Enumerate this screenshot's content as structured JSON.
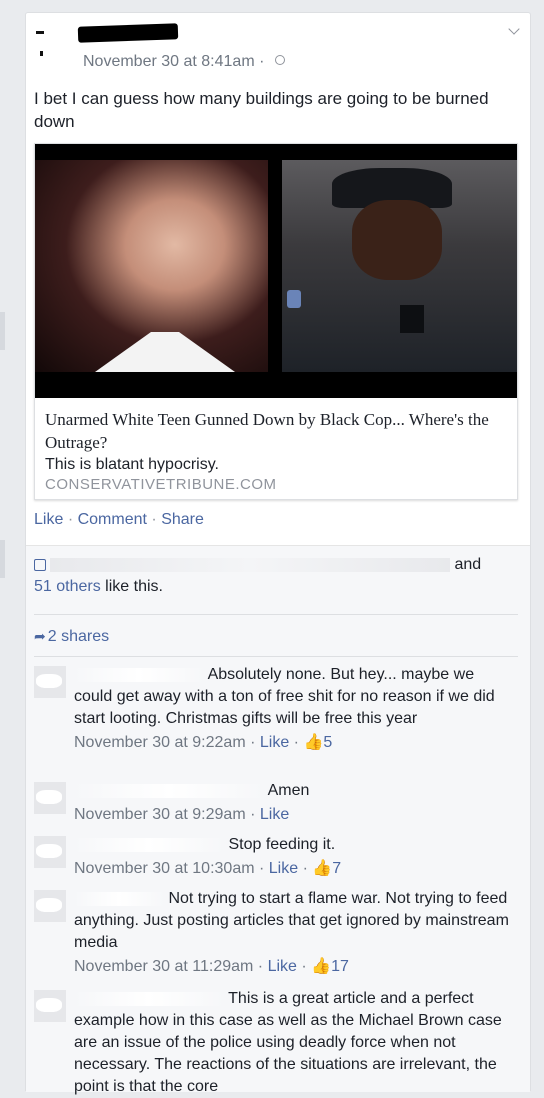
{
  "post": {
    "timestamp": "November 30 at 8:41am",
    "dot": "·",
    "text": "I bet I can guess how many buildings are going to be burned down"
  },
  "link_card": {
    "title": "Unarmed White Teen Gunned Down by Black Cop... Where's the Outrage?",
    "description": "This is blatant hypocrisy.",
    "domain": "CONSERVATIVETRIBUNE.COM"
  },
  "actions": {
    "like": "Like",
    "comment": "Comment",
    "share": "Share",
    "sep": "·"
  },
  "likes_row": {
    "suffix": "and",
    "others": "51 others",
    "tail": "like this."
  },
  "shares": {
    "label": "2 shares"
  },
  "comments": [
    {
      "text": "Absolutely none. But hey... maybe we could get away with a ton of free shit for no reason if we did start looting. Christmas gifts will be free this year",
      "time": "November 30 at 9:22am",
      "like": "Like",
      "likes": "5"
    },
    {
      "text": "Amen",
      "time": "November 30 at 9:29am",
      "like": "Like",
      "likes": ""
    },
    {
      "text": "Stop feeding it.",
      "time": "November 30 at 10:30am",
      "like": "Like",
      "likes": "7"
    },
    {
      "text": "Not trying to start a flame war. Not trying to feed anything. Just posting articles that get ignored by mainstream media",
      "time": "November 30 at 11:29am",
      "like": "Like",
      "likes": "17"
    },
    {
      "text": "This is a great article and a perfect example how in this case as well as the Michael Brown case are an issue of the police using deadly force when not necessary. The reactions of the situations are irrelevant, the point is that the core",
      "time": "",
      "like": "",
      "likes": ""
    }
  ],
  "colors": {
    "link": "#4b67a1",
    "meta": "#6f7782",
    "background": "#e9ebee"
  }
}
